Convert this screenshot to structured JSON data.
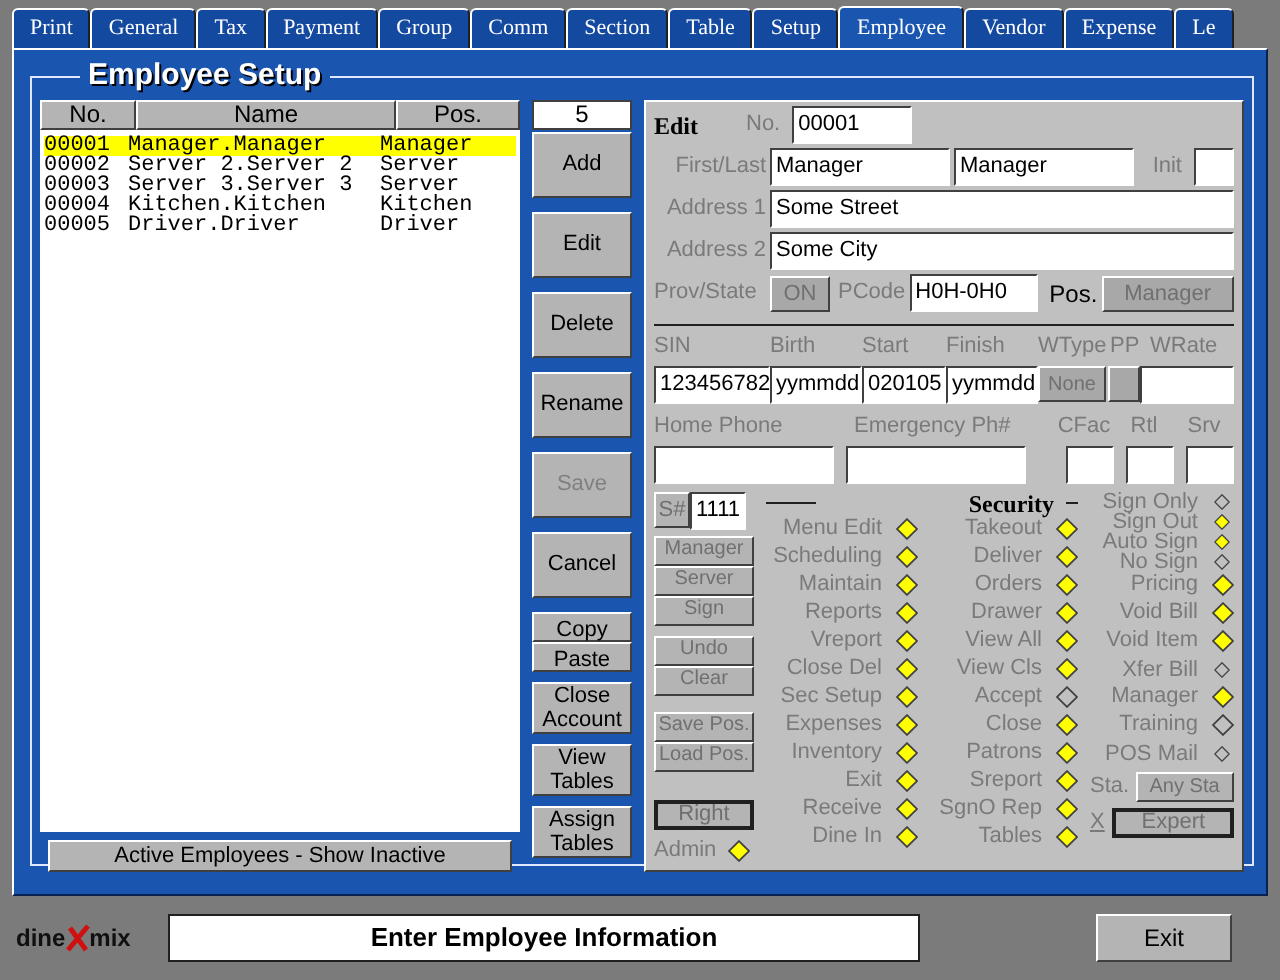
{
  "tabs": [
    {
      "label": "Print",
      "selected": false
    },
    {
      "label": "General",
      "selected": false
    },
    {
      "label": "Tax",
      "selected": false
    },
    {
      "label": "Payment",
      "selected": false
    },
    {
      "label": "Group",
      "selected": false
    },
    {
      "label": "Comm",
      "selected": false
    },
    {
      "label": "Section",
      "selected": false
    },
    {
      "label": "Table",
      "selected": false
    },
    {
      "label": "Setup",
      "selected": false
    },
    {
      "label": "Employee",
      "selected": true
    },
    {
      "label": "Vendor",
      "selected": false
    },
    {
      "label": "Expense",
      "selected": false
    },
    {
      "label": "Le",
      "selected": false
    }
  ],
  "panel_title": "Employee Setup",
  "list": {
    "columns": [
      "No.",
      "Name",
      "Pos."
    ],
    "rows": [
      {
        "no": "00001",
        "name": "Manager.Manager",
        "pos": "Manager",
        "selected": true
      },
      {
        "no": "00002",
        "name": "Server 2.Server 2",
        "pos": "Server",
        "selected": false
      },
      {
        "no": "00003",
        "name": "Server 3.Server 3",
        "pos": "Server",
        "selected": false
      },
      {
        "no": "00004",
        "name": "Kitchen.Kitchen",
        "pos": "Kitchen",
        "selected": false
      },
      {
        "no": "00005",
        "name": "Driver.Driver",
        "pos": "Driver",
        "selected": false
      }
    ],
    "filter_button": "Active Employees - Show Inactive"
  },
  "count": "5",
  "actions": [
    {
      "label": "Add",
      "kind": "big",
      "disabled": false
    },
    {
      "label": "Edit",
      "kind": "big",
      "disabled": false
    },
    {
      "label": "Delete",
      "kind": "big",
      "disabled": false
    },
    {
      "label": "Rename",
      "kind": "big",
      "disabled": false
    },
    {
      "label": "Save",
      "kind": "big",
      "disabled": true
    },
    {
      "label": "Cancel",
      "kind": "big",
      "disabled": false
    },
    {
      "label": "Copy",
      "kind": "small",
      "disabled": false
    },
    {
      "label": "Paste",
      "kind": "small",
      "disabled": false
    },
    {
      "label": "Close Account",
      "kind": "double",
      "disabled": false
    },
    {
      "label": "View Tables",
      "kind": "double",
      "disabled": false
    },
    {
      "label": "Assign Tables",
      "kind": "double",
      "disabled": false
    }
  ],
  "edit": {
    "heading": "Edit",
    "no_label": "No.",
    "no": "00001",
    "first_last_label": "First/Last",
    "first": "Manager",
    "last": "Manager",
    "init_label": "Init",
    "address1_label": "Address 1",
    "address1": "Some Street",
    "address2_label": "Address 2",
    "address2": "Some City",
    "prov_label": "Prov/State",
    "prov": "ON",
    "pcode_label": "PCode",
    "pcode": "H0H-0H0",
    "pos_label": "Pos.",
    "pos": "Manager",
    "labels_1": [
      "SIN",
      "Birth",
      "Start",
      "Finish",
      "WType",
      "PP",
      "WRate"
    ],
    "sin": "123456782",
    "birth": "yymmdd",
    "start": "020105",
    "finish": "yymmdd",
    "wtype": "None",
    "labels_2": [
      "Home Phone",
      "Emergency Ph#",
      "CFac",
      "Rtl",
      "Srv"
    ]
  },
  "security": {
    "title": "Security",
    "s_label": "S#",
    "s_value": "1111",
    "side_buttons": [
      "Manager",
      "Server",
      "Sign",
      "Undo",
      "Clear",
      "Save Pos.",
      "Load Pos."
    ],
    "right_button": "Right",
    "admin": {
      "label": "Admin",
      "on": true
    },
    "column_1": [
      {
        "label": "Menu Edit",
        "on": true
      },
      {
        "label": "Scheduling",
        "on": true
      },
      {
        "label": "Maintain",
        "on": true
      },
      {
        "label": "Reports",
        "on": true
      },
      {
        "label": "Vreport",
        "on": true
      },
      {
        "label": "Close Del",
        "on": true
      },
      {
        "label": "Sec Setup",
        "on": true
      },
      {
        "label": "Expenses",
        "on": true
      },
      {
        "label": "Inventory",
        "on": true
      },
      {
        "label": "Exit",
        "on": true
      },
      {
        "label": "Receive",
        "on": true
      },
      {
        "label": "Dine In",
        "on": true
      }
    ],
    "column_2": [
      {
        "label": "Takeout",
        "on": true
      },
      {
        "label": "Deliver",
        "on": true
      },
      {
        "label": "Orders",
        "on": true
      },
      {
        "label": "Drawer",
        "on": true
      },
      {
        "label": "View All",
        "on": true
      },
      {
        "label": "View Cls",
        "on": true
      },
      {
        "label": "Accept",
        "on": false
      },
      {
        "label": "Close",
        "on": true
      },
      {
        "label": "Patrons",
        "on": true
      },
      {
        "label": "Sreport",
        "on": true
      },
      {
        "label": "SgnO Rep",
        "on": true
      },
      {
        "label": "Tables",
        "on": true
      }
    ],
    "sign_options": [
      {
        "label": "Sign Only",
        "on": false
      },
      {
        "label": "Sign Out",
        "on": true
      },
      {
        "label": "Auto Sign",
        "on": true
      },
      {
        "label": "No Sign",
        "on": false
      }
    ],
    "column_3": [
      {
        "label": "Pricing",
        "on": true
      },
      {
        "label": "Void Bill",
        "on": true
      },
      {
        "label": "Void Item",
        "on": true
      },
      {
        "label": "Xfer Bill",
        "on": false
      },
      {
        "label": "Manager",
        "on": true
      },
      {
        "label": "Training",
        "on": false
      },
      {
        "label": "POS Mail",
        "on": false
      }
    ],
    "sta_label": "Sta.",
    "sta": "Any Sta",
    "x_label": "X",
    "expert": "Expert"
  },
  "logo": {
    "left": "dine",
    "right": "mix"
  },
  "status": "Enter Employee Information",
  "exit": "Exit"
}
